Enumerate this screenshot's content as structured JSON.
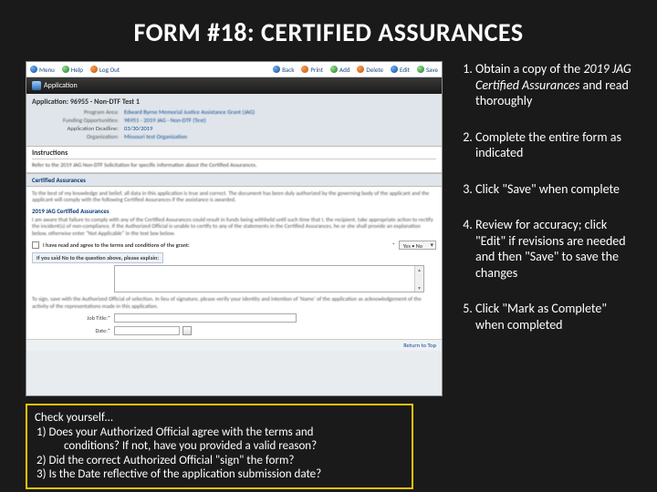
{
  "title": "FORM #18:  CERTIFIED ASSURANCES",
  "steps": [
    {
      "pre": "Obtain a copy of the ",
      "italic": "2019 JAG Certified Assurances",
      "post": " and read thoroughly"
    },
    {
      "pre": "Complete the entire form as indicated",
      "italic": "",
      "post": ""
    },
    {
      "pre": "Click \"Save\" when complete",
      "italic": "",
      "post": ""
    },
    {
      "pre": "Review for accuracy; click \"Edit\" if revisions are needed and then \"Save\" to save the changes",
      "italic": "",
      "post": ""
    },
    {
      "pre": "Click \"Mark as Complete\" when completed",
      "italic": "",
      "post": ""
    }
  ],
  "callout": {
    "head": "Check yourself…",
    "q1a": "1) Does your Authorized Official agree with the terms and",
    "q1b": "conditions?  If not, have you provided a valid reason?",
    "q2": "2) Did the correct Authorized Official \"sign\" the form?",
    "q3": "3) Is the Date reflective of the application submission date?"
  },
  "menu": {
    "home": "Menu",
    "help": "Help",
    "logout": "Log Out",
    "back": "Back",
    "print": "Print",
    "add": "Add",
    "del": "Delete",
    "edit": "Edit",
    "save": "Save"
  },
  "appbar": "Application",
  "appinfo": {
    "title": "Application: 96955 - Non-DTF Test 1",
    "rows": [
      {
        "k": "Program Area:",
        "v": "Edward Byrne Memorial Justice Assistance Grant (JAG)"
      },
      {
        "k": "Funding Opportunities:",
        "v": "96951 - 2019 JAG - Non-DTF (Test)"
      },
      {
        "k": "Application Deadline:",
        "v": "03/30/2019"
      },
      {
        "k": "Organization:",
        "v": "Missouri test Organization"
      }
    ]
  },
  "instructions": {
    "heading": "Instructions",
    "body": "Refer to the 2019 JAG Non-DTF Solicitation for specific information about the Certified Assurances."
  },
  "sectionHeader": "Certified Assurances",
  "bodyText": {
    "p1": "To the best of my knowledge and belief, all data in this application is true and correct. The document has been duly authorized by the governing body of the applicant and the applicant will comply with the following Certified Assurances if the assistance is awarded.",
    "sub": "2019 JAG Certified Assurances",
    "p2": "I am aware that failure to comply with any of the Certified Assurances could result in funds being withheld until such time that I, the recipient, take appropriate action to rectify the incident(s) of non-compliance. If the Authorized Official is unable to certify to any of the statements in the Certified Assurances, he or she shall provide an explanation below, otherwise enter \"Not Applicable\" in the text box below.",
    "agree_label": "I have read and agree to the terms and conditions of the grant:",
    "select_value": "Yes • No",
    "noLabel": "If you said No to the question above, please explain:",
    "jobLabel": "Job Title:",
    "dateLabel": "Date:",
    "p3": "To sign, save with the Authorized Official of selection. In lieu of signature, please verify your identity and intention of 'Name' of the application as acknowledgement of the activity of the representations made in this application."
  },
  "returnTop": "Return to Top"
}
